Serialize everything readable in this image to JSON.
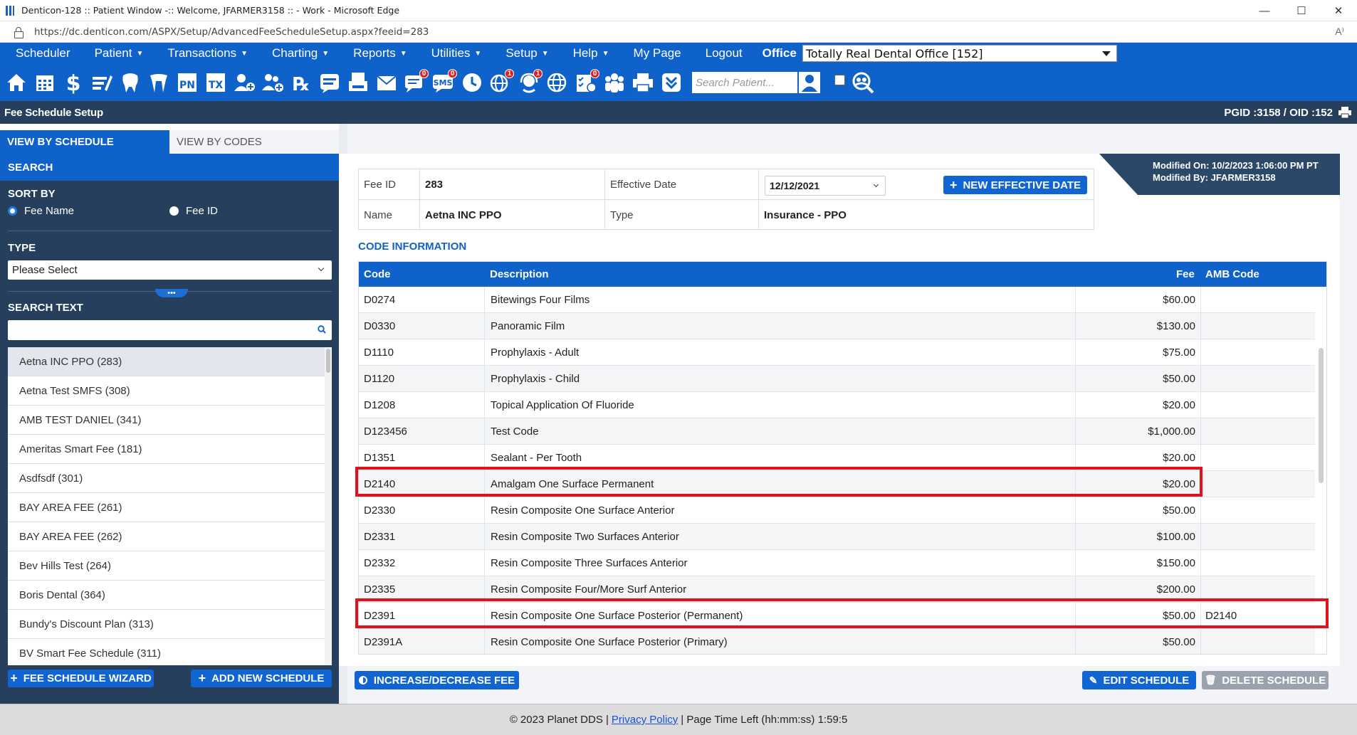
{
  "window": {
    "title": "Denticon-128 :: Patient Window -:: Welcome, JFARMER3158 :: - Work - Microsoft Edge",
    "url": "https://dc.denticon.com/ASPX/Setup/AdvancedFeeScheduleSetup.aspx?feeid=283"
  },
  "nav": {
    "items": [
      {
        "label": "Scheduler",
        "caret": false
      },
      {
        "label": "Patient",
        "caret": true
      },
      {
        "label": "Transactions",
        "caret": true
      },
      {
        "label": "Charting",
        "caret": true
      },
      {
        "label": "Reports",
        "caret": true
      },
      {
        "label": "Utilities",
        "caret": true
      },
      {
        "label": "Setup",
        "caret": true
      },
      {
        "label": "Help",
        "caret": true
      },
      {
        "label": "My Page",
        "caret": false
      },
      {
        "label": "Logout",
        "caret": false
      }
    ],
    "office_label": "Office",
    "office_value": "Totally Real Dental Office [152]"
  },
  "toolbar": {
    "search_placeholder": "Search Patient...",
    "icons": [
      "home-icon",
      "calendar-icon",
      "dollar-icon",
      "edit-note-icon",
      "tooth-icon",
      "teeth-icon",
      "pn-icon",
      "tx-icon",
      "add-patient-icon",
      "family-add-icon",
      "rx-icon",
      "notes-icon",
      "print-doc-icon",
      "email-icon",
      "message-icon",
      "sms-icon",
      "clock-icon",
      "globe-alert-icon",
      "support-icon",
      "web-icon",
      "checklist-icon",
      "group-icon",
      "printer-icon",
      "chevron-double-icon"
    ],
    "badges": {
      "message-icon": "0",
      "sms-icon": "0",
      "globe-alert-icon": "1",
      "support-icon": "1",
      "checklist-icon": "0"
    }
  },
  "section": {
    "title": "Fee Schedule Setup",
    "pgid": "PGID :3158  /  OID :152"
  },
  "left": {
    "tabs": [
      "VIEW BY SCHEDULE",
      "VIEW BY CODES"
    ],
    "search_header": "SEARCH",
    "sort_by_label": "SORT BY",
    "sort_options": [
      "Fee Name",
      "Fee ID"
    ],
    "type_label": "TYPE",
    "type_value": "Please Select",
    "search_text_label": "SEARCH TEXT",
    "search_text_value": "",
    "schedules": [
      "Aetna INC PPO (283)",
      "Aetna Test SMFS (308)",
      "AMB TEST DANIEL (341)",
      "Ameritas Smart Fee (181)",
      "Asdfsdf (301)",
      "BAY AREA FEE (261)",
      "BAY AREA FEE (262)",
      "Bev Hills Test (264)",
      "Boris Dental (364)",
      "Bundy's Discount Plan (313)",
      "BV Smart Fee Schedule (311)"
    ],
    "fee_schedule_wizard": "FEE SCHEDULE WIZARD",
    "add_new_schedule": "ADD NEW SCHEDULE"
  },
  "details": {
    "fee_id_label": "Fee ID",
    "fee_id": "283",
    "effective_date_label": "Effective Date",
    "effective_date": "12/12/2021",
    "new_effective_date": "NEW EFFECTIVE DATE",
    "name_label": "Name",
    "name": "Aetna INC PPO",
    "type_label": "Type",
    "type": "Insurance - PPO",
    "modified_on": "Modified On: 10/2/2023 1:06:00 PM PT",
    "modified_by": "Modified By: JFARMER3158"
  },
  "codes": {
    "header": "CODE INFORMATION",
    "columns": [
      "Code",
      "Description",
      "Fee",
      "AMB Code"
    ],
    "rows": [
      {
        "code": "D0274",
        "description": "Bitewings Four Films",
        "fee": "$60.00",
        "amb": ""
      },
      {
        "code": "D0330",
        "description": "Panoramic Film",
        "fee": "$130.00",
        "amb": ""
      },
      {
        "code": "D1110",
        "description": "Prophylaxis - Adult",
        "fee": "$75.00",
        "amb": ""
      },
      {
        "code": "D1120",
        "description": "Prophylaxis - Child",
        "fee": "$50.00",
        "amb": ""
      },
      {
        "code": "D1208",
        "description": "Topical Application Of Fluoride",
        "fee": "$20.00",
        "amb": ""
      },
      {
        "code": "D123456",
        "description": "Test Code",
        "fee": "$1,000.00",
        "amb": ""
      },
      {
        "code": "D1351",
        "description": "Sealant - Per Tooth",
        "fee": "$20.00",
        "amb": ""
      },
      {
        "code": "D2140",
        "description": "Amalgam One Surface Permanent",
        "fee": "$20.00",
        "amb": ""
      },
      {
        "code": "D2330",
        "description": "Resin Composite One Surface Anterior",
        "fee": "$50.00",
        "amb": ""
      },
      {
        "code": "D2331",
        "description": "Resin Composite Two Surfaces Anterior",
        "fee": "$100.00",
        "amb": ""
      },
      {
        "code": "D2332",
        "description": "Resin Composite Three Surfaces Anterior",
        "fee": "$150.00",
        "amb": ""
      },
      {
        "code": "D2335",
        "description": "Resin Composite Four/More Surf Anterior",
        "fee": "$200.00",
        "amb": ""
      },
      {
        "code": "D2391",
        "description": "Resin Composite One Surface Posterior (Permanent)",
        "fee": "$50.00",
        "amb": "D2140"
      },
      {
        "code": "D2391A",
        "description": "Resin Composite One Surface Posterior (Primary)",
        "fee": "$50.00",
        "amb": ""
      }
    ]
  },
  "actions": {
    "increase_decrease_fee": "INCREASE/DECREASE FEE",
    "edit_schedule": "EDIT SCHEDULE",
    "delete_schedule": "DELETE SCHEDULE"
  },
  "footer": {
    "copyright": "© 2023 Planet DDS",
    "privacy": "Privacy Policy",
    "time_left": "Page Time Left (hh:mm:ss) 1:59:5"
  },
  "colors": {
    "brand_blue": "#0f62c9",
    "navy": "#263f5c",
    "highlight_red": "#e0131a"
  }
}
